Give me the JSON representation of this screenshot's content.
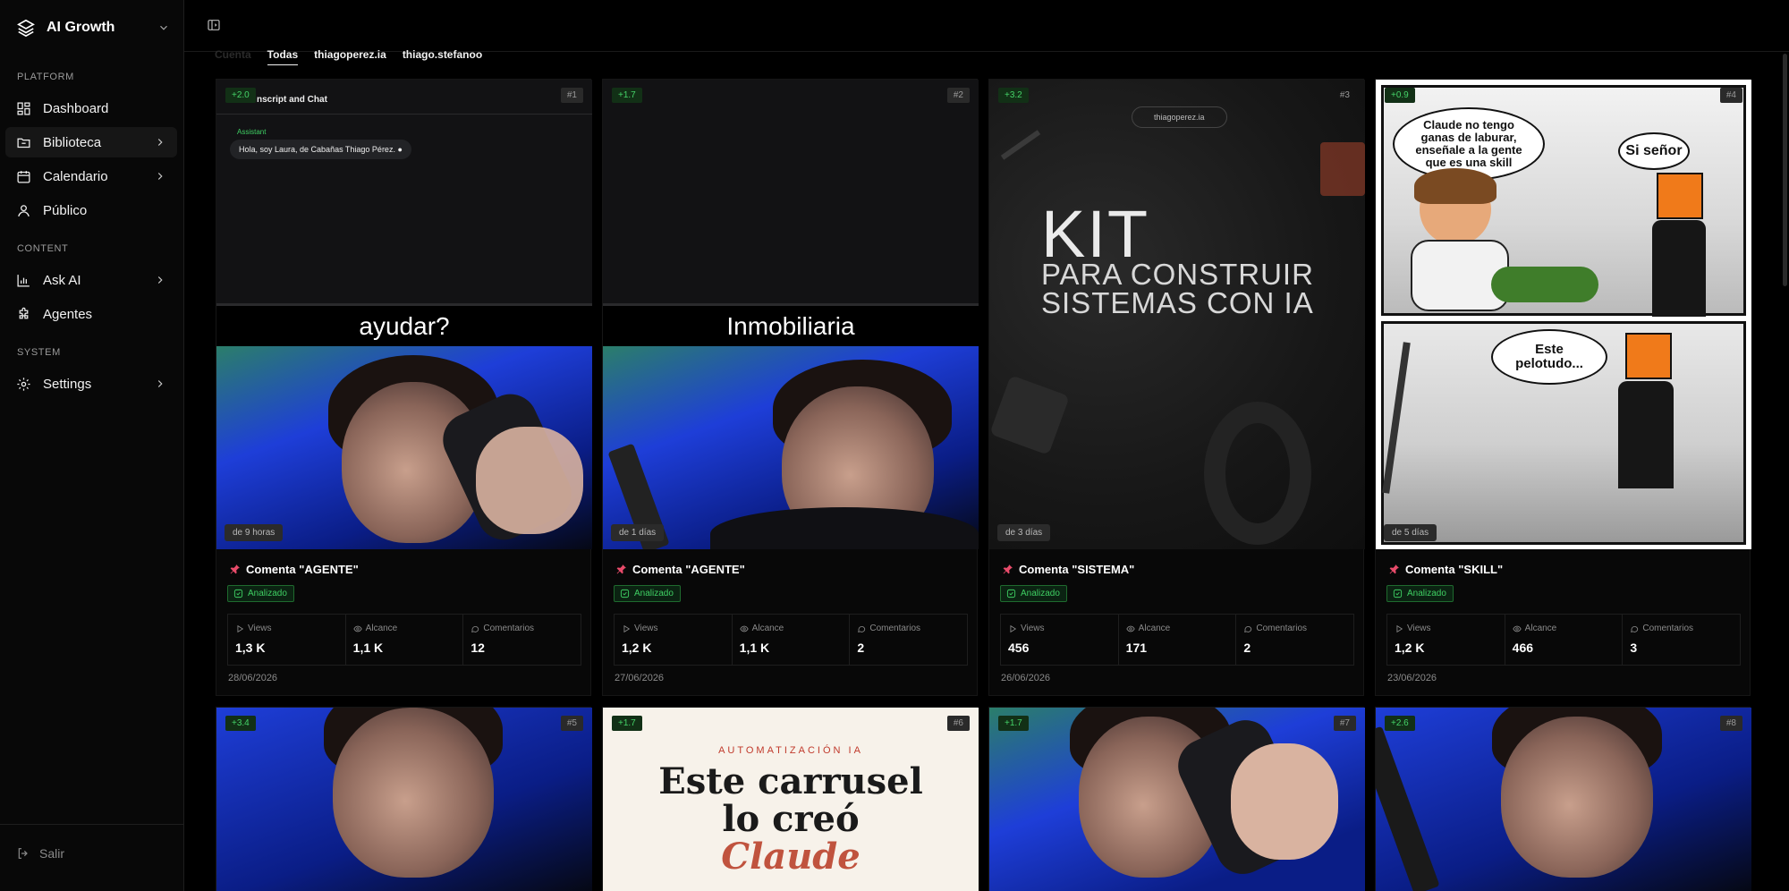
{
  "sidebar": {
    "brand": "AI Growth",
    "sections": {
      "platform": "PLATFORM",
      "content": "CONTENT",
      "system": "SYSTEM"
    },
    "items": {
      "dashboard": "Dashboard",
      "biblioteca": "Biblioteca",
      "calendario": "Calendario",
      "publico": "Público",
      "ask_ai": "Ask AI",
      "agentes": "Agentes",
      "settings": "Settings"
    },
    "logout": "Salir"
  },
  "tabs": {
    "faded": "Cuenta",
    "todas": "Todas",
    "account1": "thiagoperez.ia",
    "account2": "thiago.stefanoo"
  },
  "labels": {
    "views": "Views",
    "alcance": "Alcance",
    "comentarios": "Comentarios",
    "status": "Analizado"
  },
  "cards": [
    {
      "delta": "+2.0",
      "num": "#1",
      "time": "de 9 horas",
      "title": "Comenta \"AGENTE\"",
      "views": "1,3 K",
      "alcance": "1,1 K",
      "comentarios": "12",
      "date": "28/06/2026",
      "caption": "ayudar?",
      "screen_title": "nscript and Chat",
      "screen_role": "Assistant",
      "screen_msg": "Hola, soy Laura, de Cabañas Thiago Pérez. ●"
    },
    {
      "delta": "+1.7",
      "num": "#2",
      "time": "de 1 días",
      "title": "Comenta \"AGENTE\"",
      "views": "1,2 K",
      "alcance": "1,1 K",
      "comentarios": "2",
      "date": "27/06/2026",
      "caption": "Inmobiliaria"
    },
    {
      "delta": "+3.2",
      "num": "#3",
      "time": "de 3 días",
      "title": "Comenta \"SISTEMA\"",
      "views": "456",
      "alcance": "171",
      "comentarios": "2",
      "date": "26/06/2026",
      "pill": "thiagoperez.ia",
      "kit1": "KIT",
      "kit2": "PARA CONSTRUIR",
      "kit3": "SISTEMAS CON IA"
    },
    {
      "delta": "+0.9",
      "num": "#4",
      "time": "de 5 días",
      "title": "Comenta \"SKILL\"",
      "views": "1,2 K",
      "alcance": "466",
      "comentarios": "3",
      "date": "23/06/2026",
      "bubble1": "Claude no tengo ganas de laburar, enseñale a la gente que es una skill",
      "bubble2": "Si señor",
      "bubble3": "Este pelotudo..."
    },
    {
      "delta": "+3.4",
      "num": "#5"
    },
    {
      "delta": "+1.7",
      "num": "#6",
      "kicker": "AUTOMATIZACIÓN IA",
      "headline1": "Este carrusel",
      "headline2": "lo creó",
      "headline3": "Claude"
    },
    {
      "delta": "+1.7",
      "num": "#7"
    },
    {
      "delta": "+2.6",
      "num": "#8"
    }
  ]
}
